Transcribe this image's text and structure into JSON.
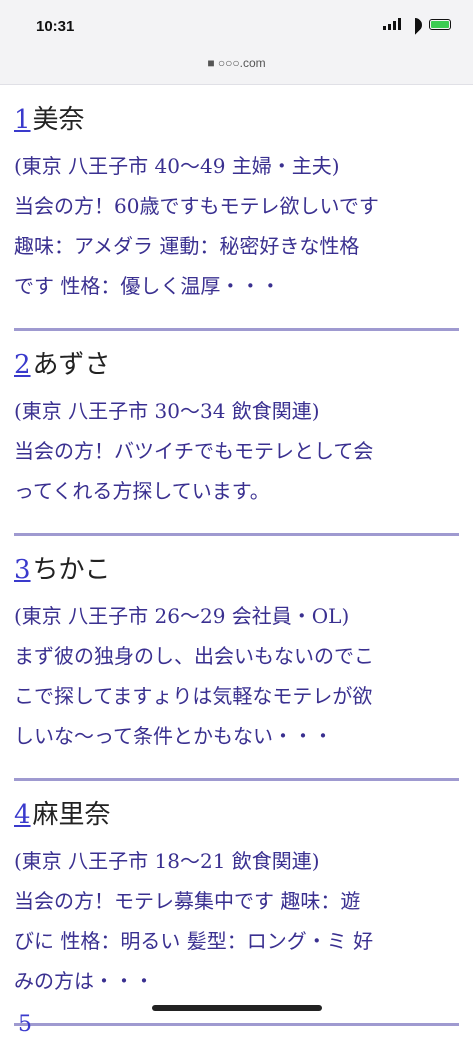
{
  "status": {
    "time": "10:31",
    "battery_color": "#3bcc52"
  },
  "browser": {
    "url": "■ ○○○.com"
  },
  "entries": [
    {
      "num": "1",
      "name": "美奈",
      "line1": "(東京 八王子市 40〜49 主婦・主夫)",
      "line2": "当会の方！60歳ですもモテレ欲しいです",
      "line3": "趣味：アメダラ 運動：秘密好きな性格",
      "line4": "です 性格：優しく温厚・・・"
    },
    {
      "num": "2",
      "name": "あずさ",
      "line1": "(東京 八王子市 30〜34 飲食関連)",
      "line2": "当会の方！バツイチでもモテレとして会",
      "line3": "ってくれる方探しています。",
      "line4": ""
    },
    {
      "num": "3",
      "name": "ちかこ",
      "line1": "(東京 八王子市 26〜29 会社員・OL)",
      "line2": "まず彼の独身のし、出会いもないのでこ",
      "line3": "こで探してますょりは気軽なモテレが欲",
      "line4": "しいな〜って条件とかもない・・・"
    },
    {
      "num": "4",
      "name": "麻里奈",
      "line1": "(東京 八王子市 18〜21 飲食関連)",
      "line2": "当会の方！モテレ募集中です 趣味：遊",
      "line3": "びに 性格：明るい 髪型：ロング・ミ 好",
      "line4": "みの方は・・・"
    }
  ],
  "partial_next": "5"
}
